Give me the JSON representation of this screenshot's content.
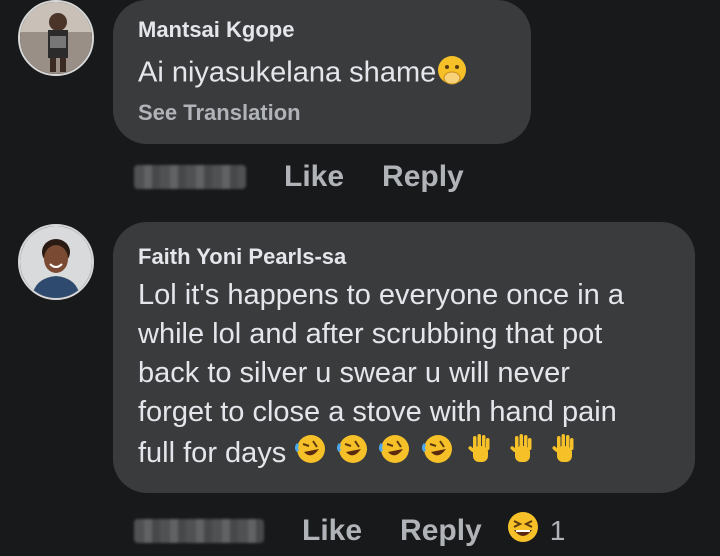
{
  "comments": [
    {
      "author": "Mantsai Kgope",
      "text": "Ai niyasukelana shame",
      "text_emoji": "face-with-hand-over-mouth",
      "see_translation": "See Translation"
    },
    {
      "author": "Faith Yoni Pearls-sa",
      "lines": [
        "Lol it's happens to everyone once in a",
        "while lol and after scrubbing that pot",
        "back to silver u swear u will never",
        "forget to close a stove with hand pain",
        "full for days"
      ],
      "text_emojis": [
        "rolling-on-floor-laughing",
        "rolling-on-floor-laughing",
        "rolling-on-floor-laughing",
        "rolling-on-floor-laughing",
        "raised-hand",
        "raised-hand",
        "raised-hand"
      ]
    }
  ],
  "actions": {
    "like": "Like",
    "reply": "Reply"
  },
  "reaction": {
    "icon": "grinning-squinting-face",
    "count": "1"
  },
  "colors": {
    "background": "#18191a",
    "bubble": "#3a3b3c",
    "text": "#e4e6eb",
    "muted": "#b0b3b8"
  }
}
